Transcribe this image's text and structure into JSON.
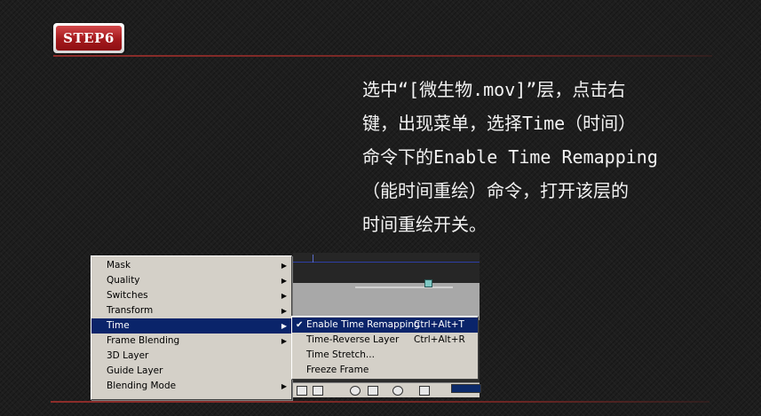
{
  "badge": {
    "label": "STEP6"
  },
  "instruction": {
    "lines": [
      "选中“[微生物.mov]”层，点击右",
      "键，出现菜单，选择Time（时间）",
      "命令下的Enable Time Remapping",
      "（能时间重绘）命令，打开该层的",
      "时间重绘开关。"
    ]
  },
  "context_menu": {
    "items": [
      {
        "label": "Mask",
        "submenu": true
      },
      {
        "label": "Quality",
        "submenu": true
      },
      {
        "label": "Switches",
        "submenu": true
      },
      {
        "label": "Transform",
        "submenu": true
      },
      {
        "label": "Time",
        "submenu": true,
        "highlighted": true
      },
      {
        "label": "Frame Blending",
        "submenu": true
      },
      {
        "label": "3D Layer",
        "submenu": false
      },
      {
        "label": "Guide Layer",
        "submenu": false
      },
      {
        "label": "Blending Mode",
        "submenu": true
      }
    ],
    "arrow_glyph": "▶"
  },
  "time_submenu": {
    "items": [
      {
        "label": "Enable Time Remapping",
        "shortcut": "Ctrl+Alt+T",
        "checked": true,
        "highlighted": true
      },
      {
        "label": "Time-Reverse Layer",
        "shortcut": "Ctrl+Alt+R",
        "checked": false
      },
      {
        "label": "Time Stretch...",
        "shortcut": "",
        "checked": false
      },
      {
        "label": "Freeze Frame",
        "shortcut": "",
        "checked": false
      }
    ],
    "check_glyph": "✔"
  },
  "colors": {
    "badge_red": "#a4191c",
    "rule_red": "#8e2d2a",
    "menu_bg": "#d4d0c8",
    "menu_highlight": "#0a246a",
    "text_light": "#f2f2f2"
  }
}
